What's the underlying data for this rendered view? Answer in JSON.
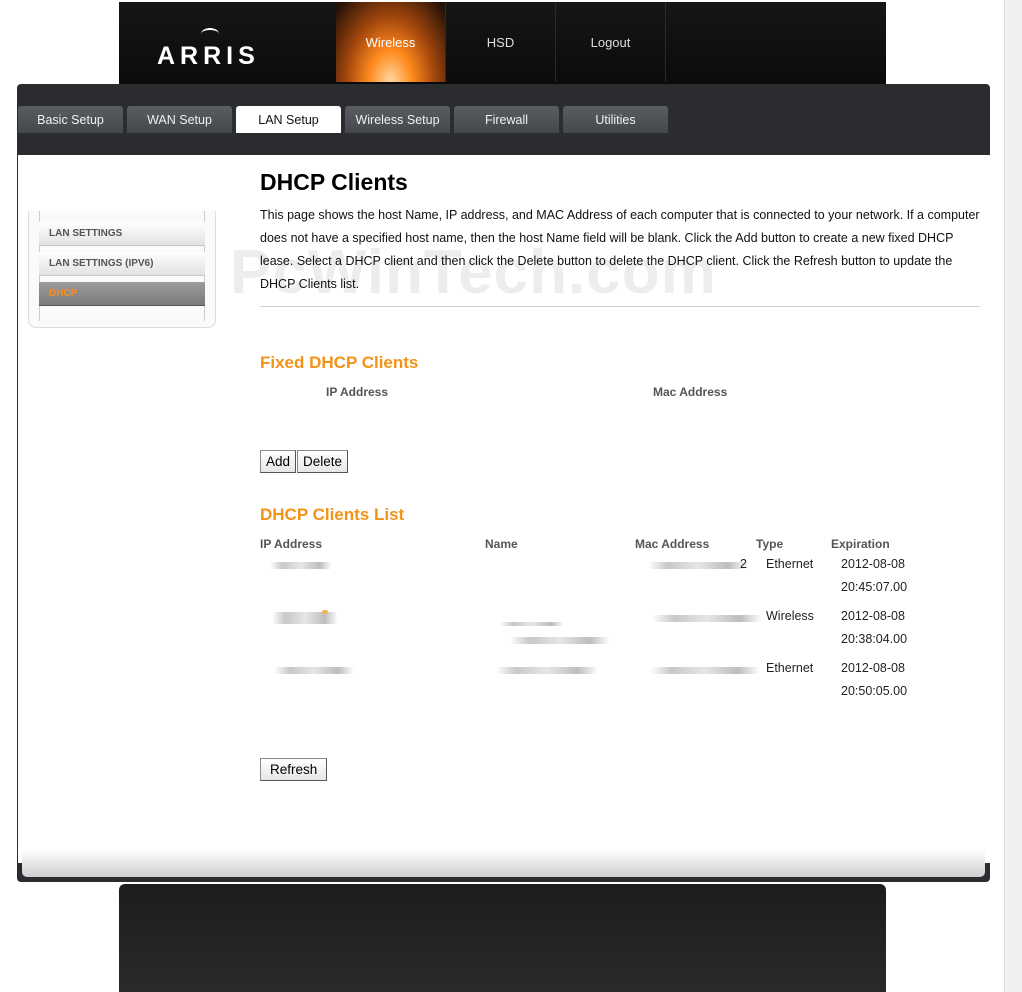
{
  "brand": {
    "logo_text": "ARRIS"
  },
  "top_nav": [
    {
      "label": "Wireless",
      "active": true
    },
    {
      "label": "HSD",
      "active": false
    },
    {
      "label": "Logout",
      "active": false
    }
  ],
  "tabs": [
    {
      "label": "Basic Setup",
      "active": false
    },
    {
      "label": "WAN Setup",
      "active": false
    },
    {
      "label": "LAN Setup",
      "active": true
    },
    {
      "label": "Wireless Setup",
      "active": false
    },
    {
      "label": "Firewall",
      "active": false
    },
    {
      "label": "Utilities",
      "active": false
    }
  ],
  "side_menu": [
    {
      "label": "LAN SETTINGS",
      "active": false
    },
    {
      "label": "LAN SETTINGS (IPV6)",
      "active": false
    },
    {
      "label": "DHCP",
      "active": true
    }
  ],
  "page": {
    "title": "DHCP Clients",
    "description": "This page shows the host Name, IP address, and MAC Address of each computer that is connected to your network. If a computer does not have a specified host name, then the host Name field will be blank. Click the Add button to create a new fixed DHCP lease. Select a DHCP client and then click the Delete button to delete the DHCP client. Click the Refresh button to update the DHCP Clients list.",
    "watermark": "PcWinTech.com"
  },
  "fixed_clients": {
    "title": "Fixed DHCP Clients",
    "col_ip": "IP Address",
    "col_mac": "Mac Address",
    "add_label": "Add",
    "delete_label": "Delete"
  },
  "clients_list": {
    "title": "DHCP Clients List",
    "headers": [
      "IP Address",
      "Name",
      "Mac Address",
      "Type",
      "Expiration"
    ],
    "rows": [
      {
        "mac_tail": "2",
        "type": "Ethernet",
        "exp_date": "2012-08-08",
        "exp_time": "20:45:07.00"
      },
      {
        "mac_tail": "",
        "type": "Wireless",
        "exp_date": "2012-08-08",
        "exp_time": "20:38:04.00"
      },
      {
        "mac_tail": "",
        "type": "Ethernet",
        "exp_date": "2012-08-08",
        "exp_time": "20:50:05.00"
      }
    ],
    "refresh_label": "Refresh"
  },
  "colors": {
    "accent": "#f39215",
    "active_glow": "#ff8a1e",
    "header_bg": "#111111",
    "frame_bg": "#2a2c2f"
  }
}
